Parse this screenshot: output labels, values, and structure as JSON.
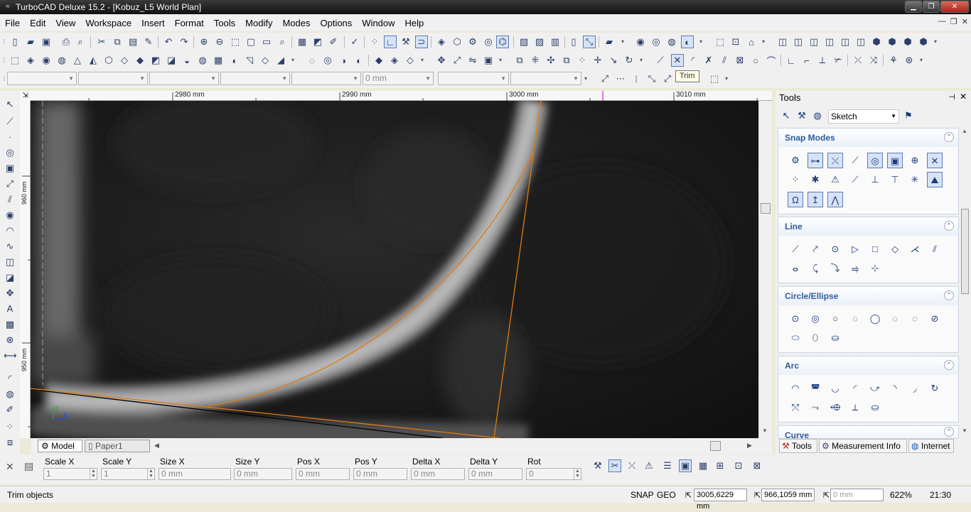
{
  "window": {
    "title": "TurboCAD Deluxe 15.2 - [Kobuz_L5 World Plan]"
  },
  "menu": [
    "File",
    "Edit",
    "View",
    "Workspace",
    "Insert",
    "Format",
    "Tools",
    "Modify",
    "Modes",
    "Options",
    "Window",
    "Help"
  ],
  "toolbar": {
    "tooltip": "Trim",
    "combo_length": "0 mm"
  },
  "ruler": {
    "h_labels": [
      "2980 mm",
      "2990 mm",
      "3000 mm",
      "3010 mm"
    ],
    "v_labels": [
      "960 mm",
      "950 mm"
    ]
  },
  "tabs": {
    "model": "Model",
    "paper": "Paper1"
  },
  "panel": {
    "title": "Tools",
    "mode_select": "Sketch",
    "sections": {
      "snap": "Snap Modes",
      "line": "Line",
      "circle": "Circle/Ellipse",
      "arc": "Arc",
      "curve": "Curve"
    },
    "bottom_tabs": {
      "tools": "Tools",
      "measure": "Measurement Info",
      "internet": "Internet"
    }
  },
  "props": {
    "scale_x": {
      "label": "Scale X",
      "value": "1"
    },
    "scale_y": {
      "label": "Scale Y",
      "value": "1"
    },
    "size_x": {
      "label": "Size X",
      "value": "0 mm"
    },
    "size_y": {
      "label": "Size Y",
      "value": "0 mm"
    },
    "pos_x": {
      "label": "Pos X",
      "value": "0 mm"
    },
    "pos_y": {
      "label": "Pos Y",
      "value": "0 mm"
    },
    "delta_x": {
      "label": "Delta X",
      "value": "0 mm"
    },
    "delta_y": {
      "label": "Delta Y",
      "value": "0 mm"
    },
    "rot": {
      "label": "Rot",
      "value": "0"
    }
  },
  "status": {
    "message": "Trim objects",
    "snap": "SNAP",
    "geo": "GEO",
    "coord_x": "3005,6229 mm",
    "coord_y": "966,1059 mm",
    "coord_z": "0 mm",
    "zoom": "622%",
    "time": "21:30"
  }
}
